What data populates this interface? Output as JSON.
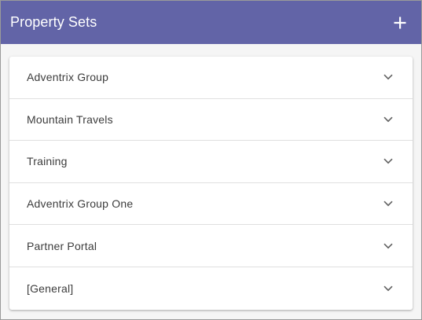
{
  "header": {
    "title": "Property Sets",
    "add_icon": "plus-icon"
  },
  "colors": {
    "header_bg": "#6264a7",
    "header_text": "#ffffff",
    "card_bg": "#ffffff",
    "divider": "#e0e0e0",
    "item_text": "#3c3c3c",
    "chevron": "#616161"
  },
  "property_sets": [
    {
      "label": "Adventrix Group",
      "icon": "chevron-down-icon"
    },
    {
      "label": "Mountain Travels",
      "icon": "chevron-down-icon"
    },
    {
      "label": "Training",
      "icon": "chevron-down-icon"
    },
    {
      "label": "Adventrix Group One",
      "icon": "chevron-down-icon"
    },
    {
      "label": "Partner Portal",
      "icon": "chevron-down-icon"
    },
    {
      "label": "[General]",
      "icon": "chevron-down-icon"
    }
  ]
}
